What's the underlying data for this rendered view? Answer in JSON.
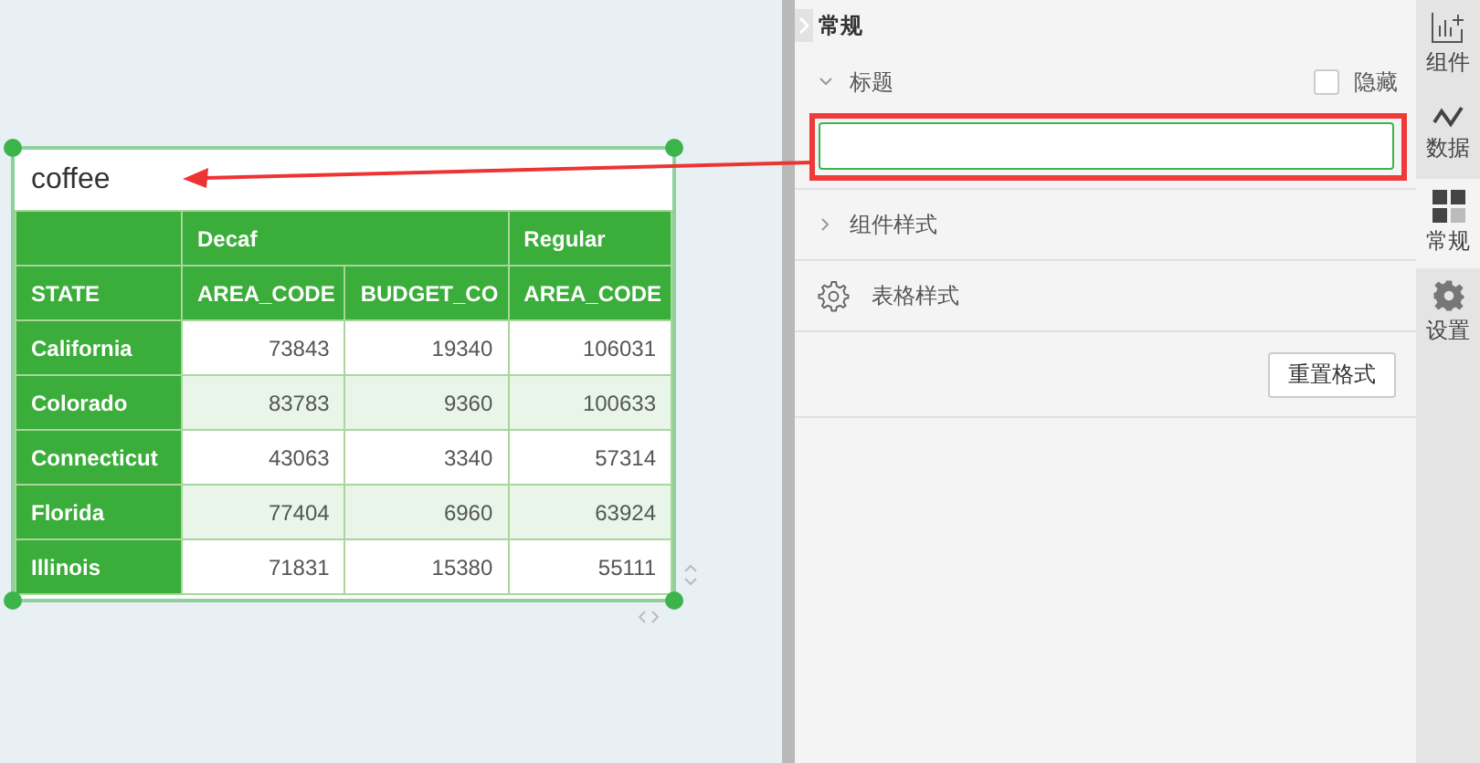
{
  "widget": {
    "title": "coffee",
    "group_headers": [
      "Decaf",
      "Regular"
    ],
    "columns": [
      "STATE",
      "AREA_CODE",
      "BUDGET_CO",
      "AREA_CODE"
    ],
    "rows": [
      [
        "California",
        "73843",
        "19340",
        "106031"
      ],
      [
        "Colorado",
        "83783",
        "9360",
        "100633"
      ],
      [
        "Connecticut",
        "43063",
        "3340",
        "57314"
      ],
      [
        "Florida",
        "77404",
        "6960",
        "63924"
      ],
      [
        "Illinois",
        "71831",
        "15380",
        "55111"
      ]
    ]
  },
  "panel": {
    "title": "常规",
    "sections": [
      {
        "kind": "title",
        "label": "标题",
        "expanded": true,
        "hide_label": "隐藏",
        "hide_checked": false
      },
      {
        "kind": "collapsible",
        "label": "组件样式",
        "expanded": false
      },
      {
        "kind": "settings",
        "label": "表格样式"
      }
    ],
    "reset_button": "重置格式"
  },
  "side_tabs": [
    {
      "label": "组件",
      "selected": false
    },
    {
      "label": "数据",
      "selected": false
    },
    {
      "label": "常规",
      "selected": true
    },
    {
      "label": "设置",
      "selected": false
    }
  ]
}
